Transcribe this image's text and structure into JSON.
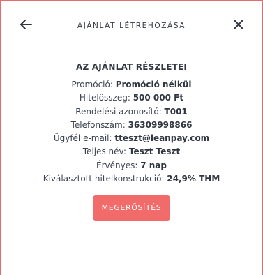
{
  "header": {
    "title": "AJÁNLAT LÉTREHOZÁSA"
  },
  "details": {
    "section_title": "AZ AJÁNLAT RÉSZLETEI",
    "rows": [
      {
        "label": "Promóció: ",
        "value": "Promóció nélkül"
      },
      {
        "label": "Hitelösszeg: ",
        "value": "500 000 Ft"
      },
      {
        "label": "Rendelési azonosító: ",
        "value": "T001"
      },
      {
        "label": "Telefonszám: ",
        "value": "36309998866"
      },
      {
        "label": "Ügyfél e-mail: ",
        "value": "tteszt@leanpay.com"
      },
      {
        "label": "Teljes név: ",
        "value": "Teszt Teszt"
      },
      {
        "label": "Érvényes: ",
        "value": "7 nap"
      },
      {
        "label": "Kiválasztott hitelkonstrukció: ",
        "value": "24,9% THM"
      }
    ]
  },
  "actions": {
    "confirm_label": "MEGERŐSÍTÉS"
  },
  "colors": {
    "accent": "#f26b6b",
    "frame_border": "#e26d6d"
  },
  "icons": {
    "back": "arrow-left-icon",
    "close": "close-icon"
  }
}
